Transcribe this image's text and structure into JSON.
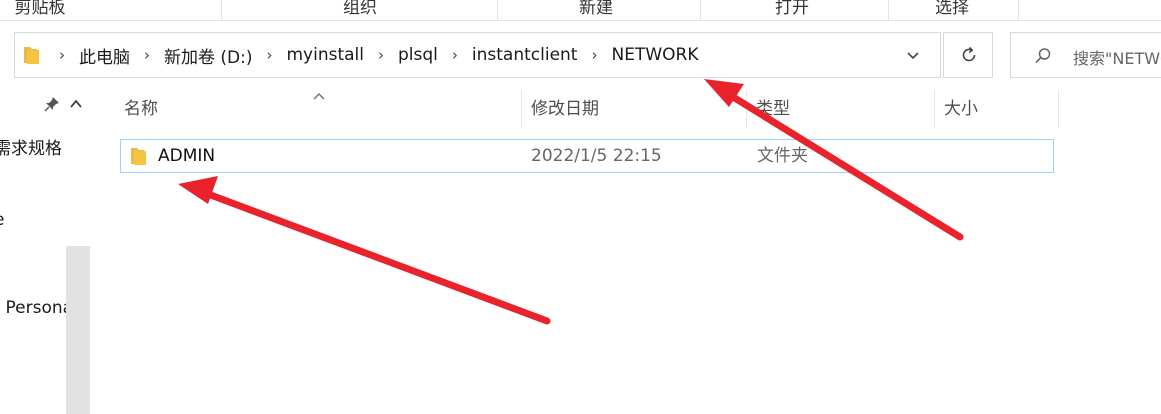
{
  "ribbon": {
    "clipboard": "剪贴板",
    "organize": "组织",
    "new": "新建",
    "open": "打开",
    "select": "选择"
  },
  "address": {
    "crumbs": [
      "此电脑",
      "新加卷 (D:)",
      "myinstall",
      "plsql",
      "instantclient",
      "NETWORK"
    ]
  },
  "search": {
    "placeholder": "搜索\"NETWORK\""
  },
  "nav": {
    "items": [
      "需求规格",
      "e",
      "- Personal"
    ]
  },
  "columns": {
    "name": "名称",
    "date": "修改日期",
    "type": "类型",
    "size": "大小"
  },
  "files": [
    {
      "name": "ADMIN",
      "date": "2022/1/5 22:15",
      "type": "文件夹",
      "size": ""
    }
  ],
  "colors": {
    "selection_border": "#99d1ff",
    "folder_yellow": "#f5c542",
    "annotation_arrow": "#e8232b"
  }
}
